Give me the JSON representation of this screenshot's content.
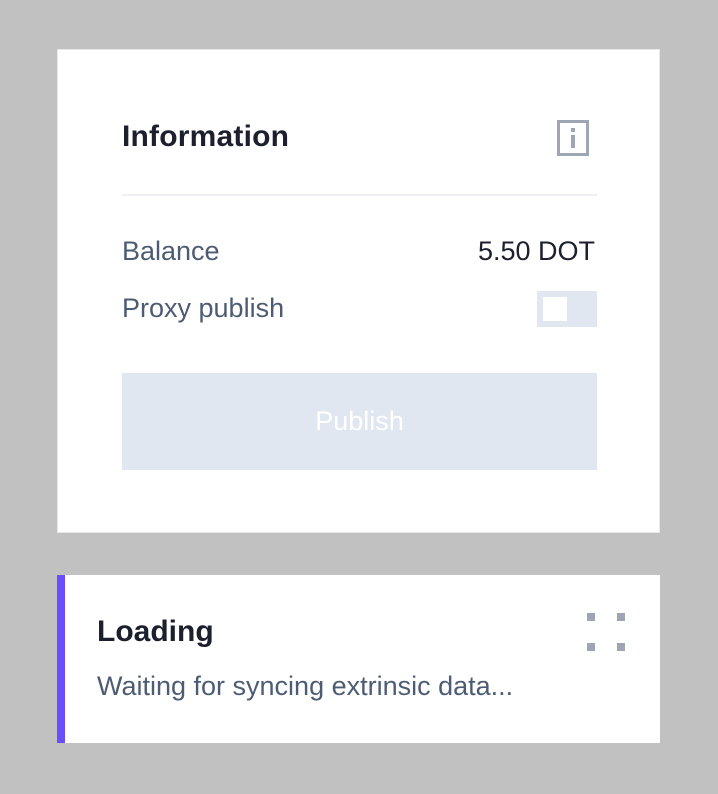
{
  "information": {
    "title": "Information",
    "info_icon": "info-icon",
    "balance_label": "Balance",
    "balance_value": "5.50 DOT",
    "proxy_publish_label": "Proxy publish",
    "proxy_publish_enabled": false,
    "publish_label": "Publish"
  },
  "loading": {
    "title": "Loading",
    "message": "Waiting for syncing extrinsic data...",
    "drag_icon": "drag-handle-icon"
  },
  "colors": {
    "background": "#c1c1c1",
    "card": "#ffffff",
    "accent": "#6a4dff",
    "muted_button": "#e0e7f1",
    "label_text": "#4d5c73",
    "heading_text": "#1b1f2e"
  }
}
